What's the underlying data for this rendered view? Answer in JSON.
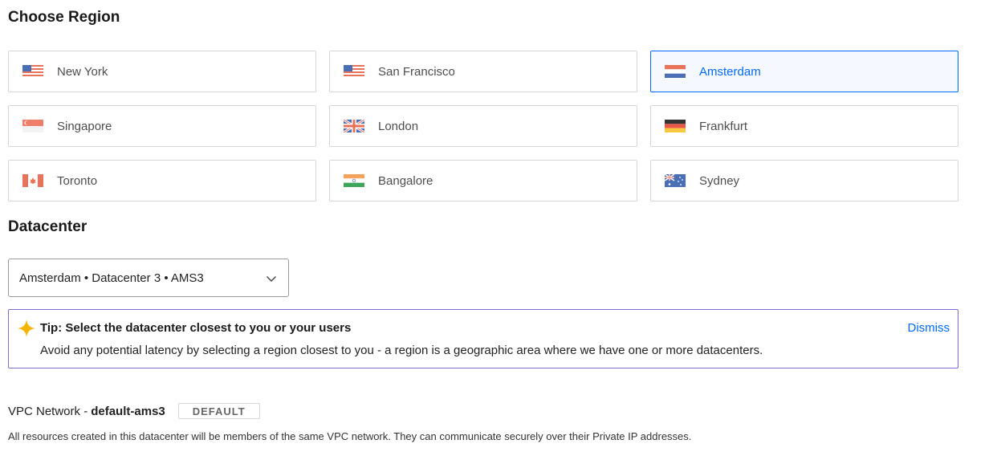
{
  "region_section": {
    "title": "Choose Region",
    "regions": [
      {
        "label": "New York",
        "flag": "us-flag-icon",
        "selected": false
      },
      {
        "label": "San Francisco",
        "flag": "us-flag-icon",
        "selected": false
      },
      {
        "label": "Amsterdam",
        "flag": "netherlands-flag-icon",
        "selected": true
      },
      {
        "label": "Singapore",
        "flag": "singapore-flag-icon",
        "selected": false
      },
      {
        "label": "London",
        "flag": "uk-flag-icon",
        "selected": false
      },
      {
        "label": "Frankfurt",
        "flag": "germany-flag-icon",
        "selected": false
      },
      {
        "label": "Toronto",
        "flag": "canada-flag-icon",
        "selected": false
      },
      {
        "label": "Bangalore",
        "flag": "india-flag-icon",
        "selected": false
      },
      {
        "label": "Sydney",
        "flag": "australia-flag-icon",
        "selected": false
      }
    ]
  },
  "datacenter_section": {
    "title": "Datacenter",
    "selected_value": "Amsterdam • Datacenter 3 • AMS3"
  },
  "tip": {
    "title": "Tip: Select the datacenter closest to you or your users",
    "body": "Avoid any potential latency by selecting a region closest to you - a region is a geographic area where we have one or more datacenters.",
    "dismiss_label": "Dismiss",
    "icon": "sparkle-icon"
  },
  "vpc": {
    "label": "VPC Network -",
    "name": "default-ams3",
    "badge": "DEFAULT",
    "description": "All resources created in this datacenter will be members of the same VPC network. They can communicate securely over their Private IP addresses."
  },
  "colors": {
    "accent": "#0069ff",
    "tip_border": "#7b6fd6",
    "card_border": "#d6d6d6"
  }
}
